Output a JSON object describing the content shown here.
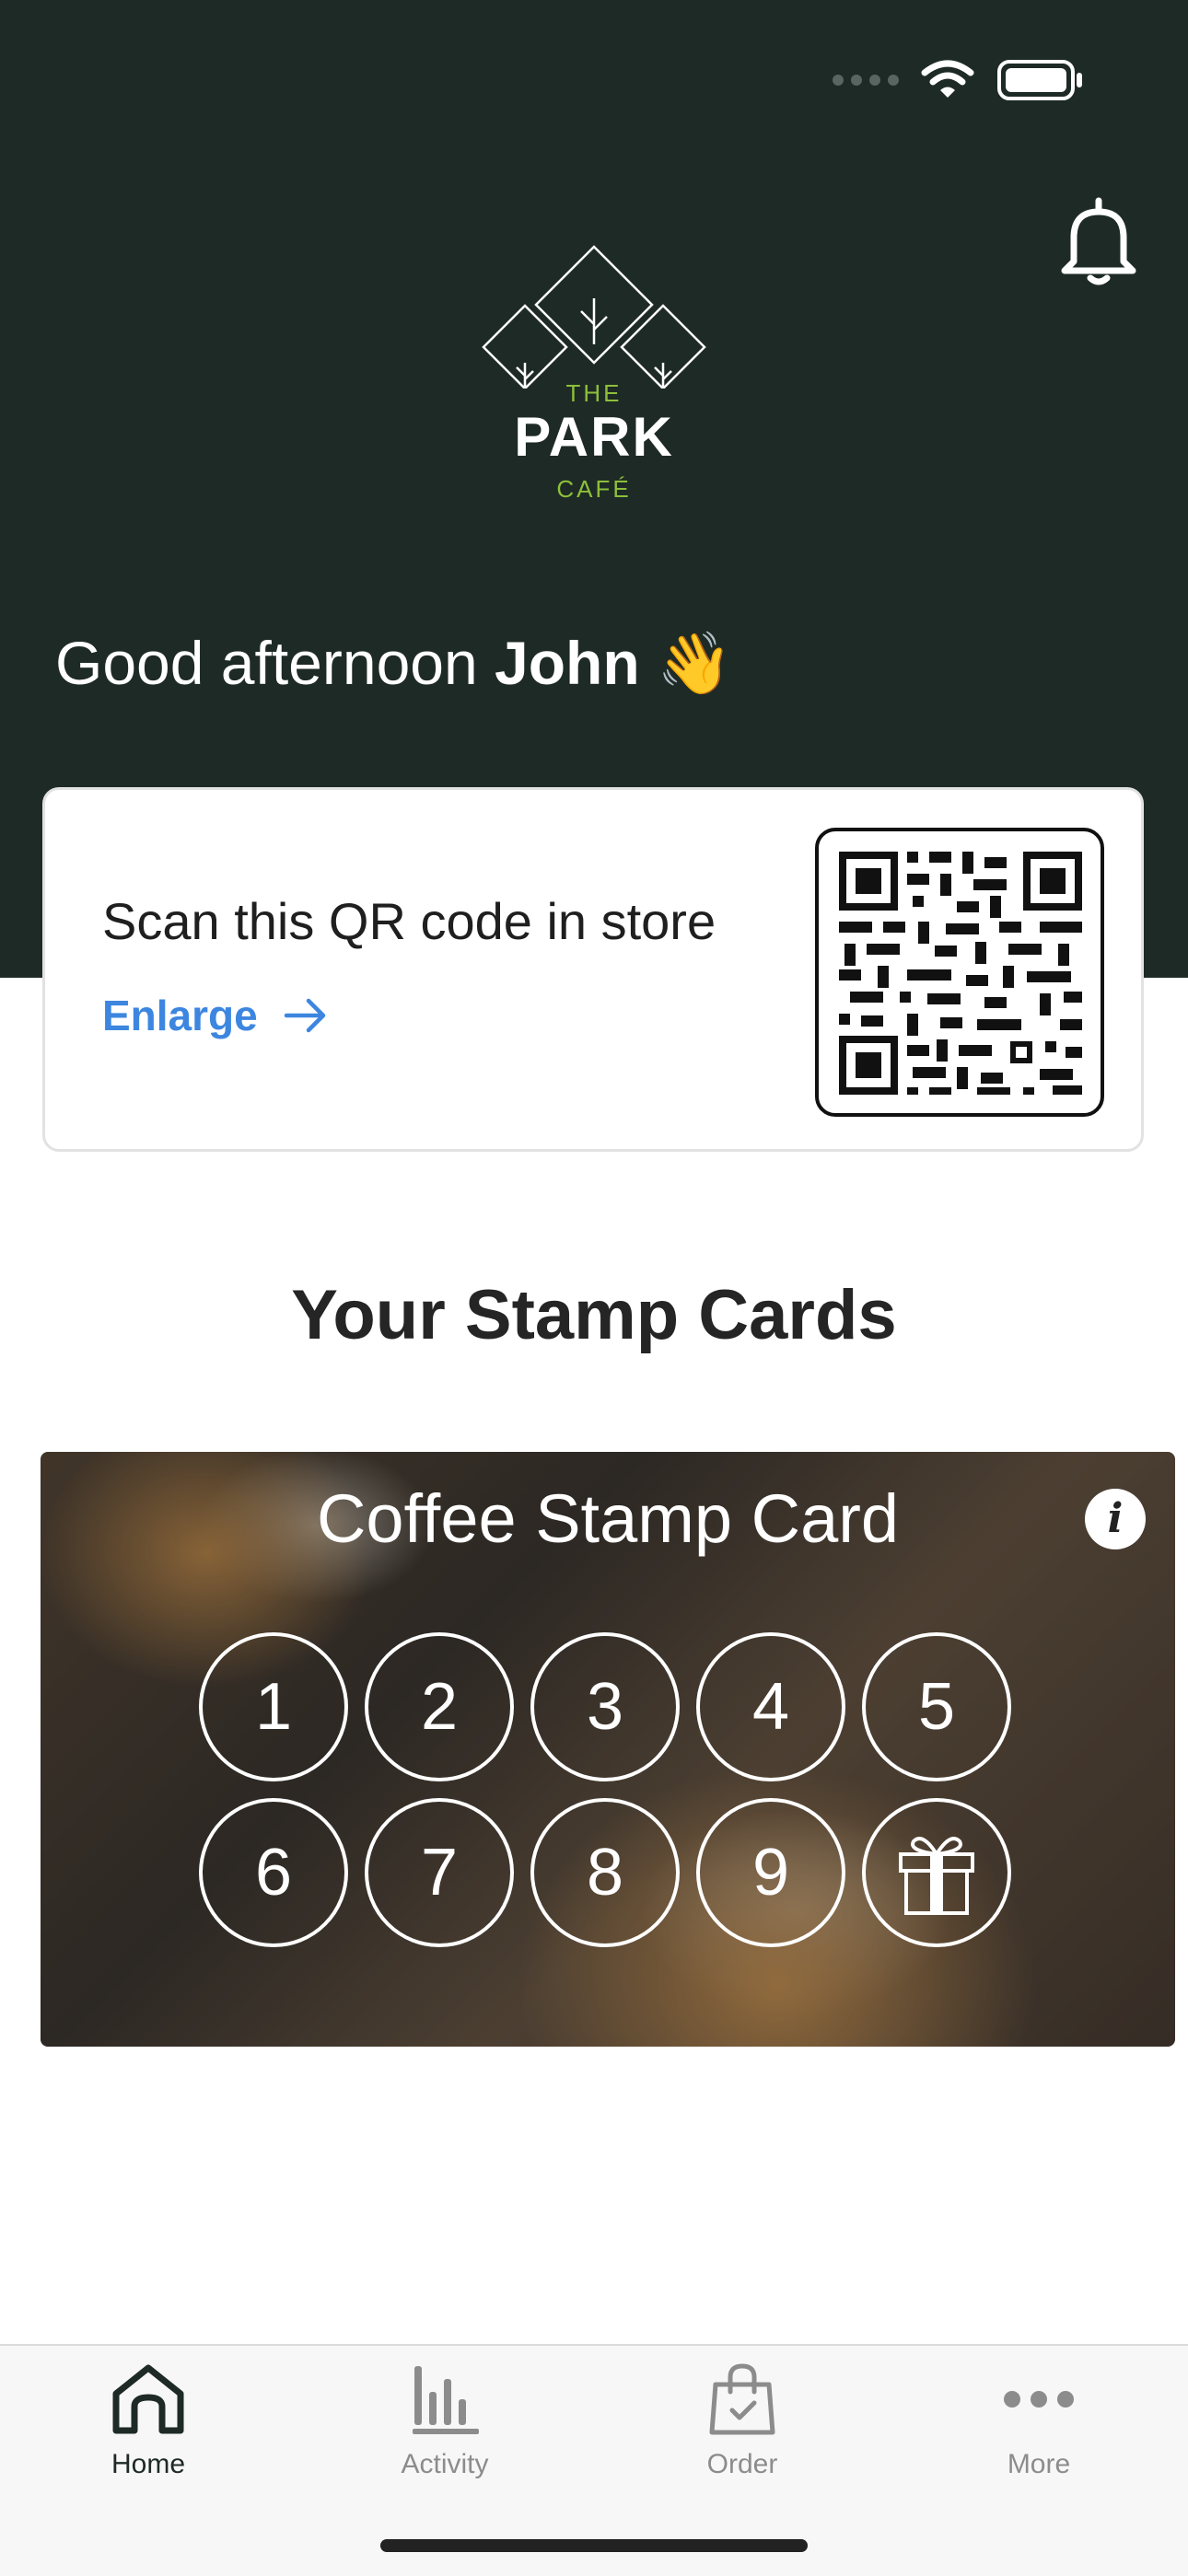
{
  "colors": {
    "header_bg": "#1e2a25",
    "accent_green": "#8dbf3a",
    "link_blue": "#3d86e0",
    "tab_active": "#1e2a25",
    "tab_inactive": "#8c8c8c"
  },
  "status_bar": {
    "icons": [
      "signal-icon",
      "wifi-icon",
      "battery-icon"
    ]
  },
  "header": {
    "logo": {
      "the": "THE",
      "park": "PARK",
      "cafe": "CAFÉ"
    },
    "greeting_prefix": "Good afternoon ",
    "user_name": "John",
    "greeting_emoji": "👋",
    "notification_icon": "bell-icon"
  },
  "qr_card": {
    "text": "Scan this QR code in store",
    "enlarge_label": "Enlarge",
    "enlarge_icon": "arrow-right-icon"
  },
  "stamp_section": {
    "title": "Your Stamp Cards",
    "card": {
      "title": "Coffee Stamp Card",
      "info_label": "i",
      "stamps": [
        "1",
        "2",
        "3",
        "4",
        "5",
        "6",
        "7",
        "8",
        "9"
      ],
      "reward_icon": "gift-icon"
    }
  },
  "tab_bar": {
    "tabs": [
      {
        "label": "Home",
        "icon": "home-icon",
        "active": true
      },
      {
        "label": "Activity",
        "icon": "bar-chart-icon",
        "active": false
      },
      {
        "label": "Order",
        "icon": "shopping-bag-icon",
        "active": false
      },
      {
        "label": "More",
        "icon": "more-icon",
        "active": false
      }
    ]
  }
}
